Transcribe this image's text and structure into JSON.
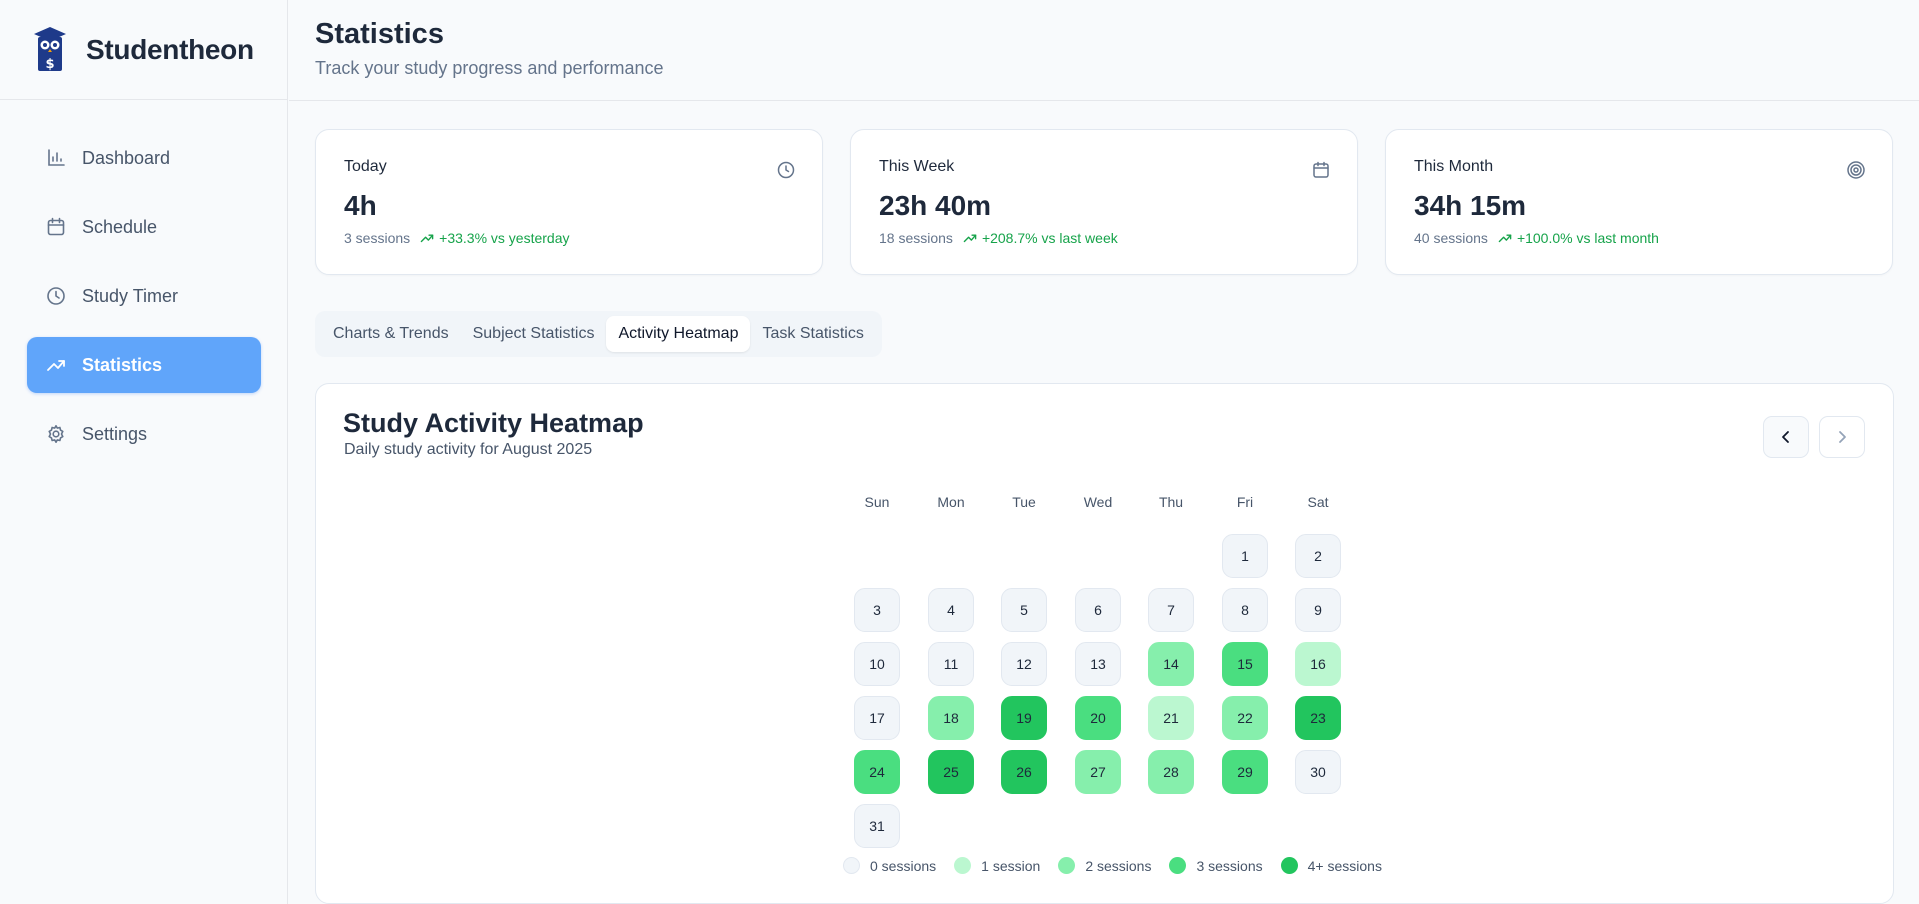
{
  "app": {
    "name": "Studentheon"
  },
  "sidebar": {
    "items": [
      {
        "label": "Dashboard",
        "icon": "bar-chart-icon"
      },
      {
        "label": "Schedule",
        "icon": "calendar-icon"
      },
      {
        "label": "Study Timer",
        "icon": "clock-icon"
      },
      {
        "label": "Statistics",
        "icon": "trending-up-icon",
        "active": true
      },
      {
        "label": "Settings",
        "icon": "gear-icon"
      }
    ]
  },
  "header": {
    "title": "Statistics",
    "subtitle": "Track your study progress and performance"
  },
  "stats": [
    {
      "label": "Today",
      "value": "4h",
      "sessions": "3 sessions",
      "trend": "+33.3% vs yesterday",
      "icon": "clock-icon"
    },
    {
      "label": "This Week",
      "value": "23h 40m",
      "sessions": "18 sessions",
      "trend": "+208.7% vs last week",
      "icon": "calendar-icon"
    },
    {
      "label": "This Month",
      "value": "34h 15m",
      "sessions": "40 sessions",
      "trend": "+100.0% vs last month",
      "icon": "target-icon"
    }
  ],
  "tabs": [
    {
      "label": "Charts & Trends"
    },
    {
      "label": "Subject Statistics"
    },
    {
      "label": "Activity Heatmap",
      "active": true
    },
    {
      "label": "Task Statistics"
    }
  ],
  "heatmap": {
    "title": "Study Activity Heatmap",
    "subtitle": "Daily study activity for August 2025",
    "weekdays": [
      "Sun",
      "Mon",
      "Tue",
      "Wed",
      "Thu",
      "Fri",
      "Sat"
    ],
    "first_weekday_index": 5,
    "days": [
      {
        "day": "1",
        "level": 0
      },
      {
        "day": "2",
        "level": 0
      },
      {
        "day": "3",
        "level": 0
      },
      {
        "day": "4",
        "level": 0
      },
      {
        "day": "5",
        "level": 0
      },
      {
        "day": "6",
        "level": 0
      },
      {
        "day": "7",
        "level": 0
      },
      {
        "day": "8",
        "level": 0
      },
      {
        "day": "9",
        "level": 0
      },
      {
        "day": "10",
        "level": 0
      },
      {
        "day": "11",
        "level": 0
      },
      {
        "day": "12",
        "level": 0
      },
      {
        "day": "13",
        "level": 0
      },
      {
        "day": "14",
        "level": 2
      },
      {
        "day": "15",
        "level": 3
      },
      {
        "day": "16",
        "level": 1
      },
      {
        "day": "17",
        "level": 0
      },
      {
        "day": "18",
        "level": 2
      },
      {
        "day": "19",
        "level": 4
      },
      {
        "day": "20",
        "level": 3
      },
      {
        "day": "21",
        "level": 1
      },
      {
        "day": "22",
        "level": 2
      },
      {
        "day": "23",
        "level": 4
      },
      {
        "day": "24",
        "level": 3
      },
      {
        "day": "25",
        "level": 4
      },
      {
        "day": "26",
        "level": 4
      },
      {
        "day": "27",
        "level": 2
      },
      {
        "day": "28",
        "level": 2
      },
      {
        "day": "29",
        "level": 3
      },
      {
        "day": "30",
        "level": 0
      },
      {
        "day": "31",
        "level": 0
      }
    ],
    "legend": [
      {
        "label": "0 sessions",
        "color": "#f1f5f9"
      },
      {
        "label": "1 session",
        "color": "#bbf7d0"
      },
      {
        "label": "2 sessions",
        "color": "#86efac"
      },
      {
        "label": "3 sessions",
        "color": "#4ade80"
      },
      {
        "label": "4+ sessions",
        "color": "#22c55e"
      }
    ]
  },
  "colors": {
    "accent": "#60a5fa",
    "positive": "#16a34a"
  }
}
